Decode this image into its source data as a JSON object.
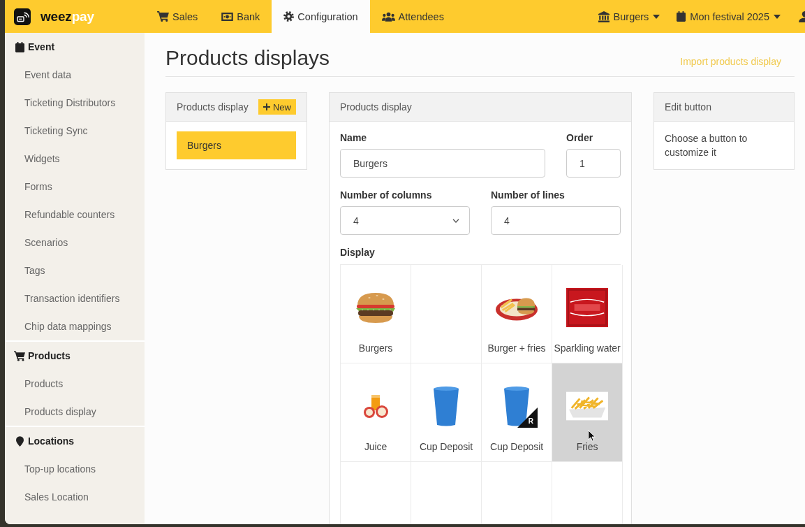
{
  "top_bar": {
    "logo": {
      "text": "weez",
      "accent": "pay"
    },
    "tabs": [
      {
        "label": "Sales",
        "selected": false
      },
      {
        "label": "Bank",
        "selected": false
      },
      {
        "label": "Configuration",
        "selected": true
      },
      {
        "label": "Attendees",
        "selected": false
      }
    ],
    "selectors": [
      {
        "label": "Burgers"
      },
      {
        "label": "Mon festival 2025"
      }
    ]
  },
  "sidebar": {
    "sections": [
      {
        "title": "Event",
        "items": [
          "Event data",
          "Ticketing Distributors",
          "Ticketing Sync",
          "Widgets",
          "Forms",
          "Refundable counters",
          "Scenarios",
          "Tags",
          "Transaction identifiers",
          "Chip data mappings"
        ]
      },
      {
        "title": "Products",
        "items": [
          "Products",
          "Products display"
        ]
      },
      {
        "title": "Locations",
        "items": [
          "Top-up locations",
          "Sales Location"
        ]
      }
    ]
  },
  "page": {
    "title": "Products displays",
    "import_link": "Import products display"
  },
  "list_panel": {
    "title": "Products display",
    "new_button": "New",
    "items": [
      {
        "label": "Burgers",
        "selected": true
      }
    ]
  },
  "form_panel": {
    "title": "Products display",
    "rows": [
      [
        {
          "kind": "text",
          "label": "Name",
          "value": "Burgers"
        },
        {
          "kind": "text",
          "label": "Order",
          "value": "1"
        }
      ],
      [
        {
          "kind": "select",
          "label": "Number of columns",
          "value": "4"
        },
        {
          "kind": "text",
          "label": "Number of lines",
          "value": "4"
        }
      ]
    ],
    "display": {
      "label": "Display",
      "buttons": [
        {
          "kind": "burger",
          "label": "Burgers",
          "hovered": false
        },
        {
          "kind": "empty",
          "hovered": false
        },
        {
          "kind": "burger_fries",
          "label": "Burger + fries",
          "hovered": false
        },
        {
          "kind": "water",
          "label": "Sparkling water",
          "hovered": false
        },
        {
          "kind": "juice",
          "label": "Juice",
          "hovered": false
        },
        {
          "kind": "cup",
          "label": "Cup Deposit",
          "hovered": false
        },
        {
          "kind": "cup",
          "label": "Cup Deposit",
          "badge": "R",
          "hovered": false
        },
        {
          "kind": "fries",
          "label": "Fries",
          "hovered": true
        },
        {
          "kind": "empty",
          "hovered": false
        },
        {
          "kind": "empty",
          "hovered": false
        },
        {
          "kind": "empty",
          "hovered": false
        },
        {
          "kind": "empty",
          "hovered": false
        }
      ]
    }
  },
  "edit_panel": {
    "title": "Edit button",
    "hint": "Choose a button to customize it"
  }
}
